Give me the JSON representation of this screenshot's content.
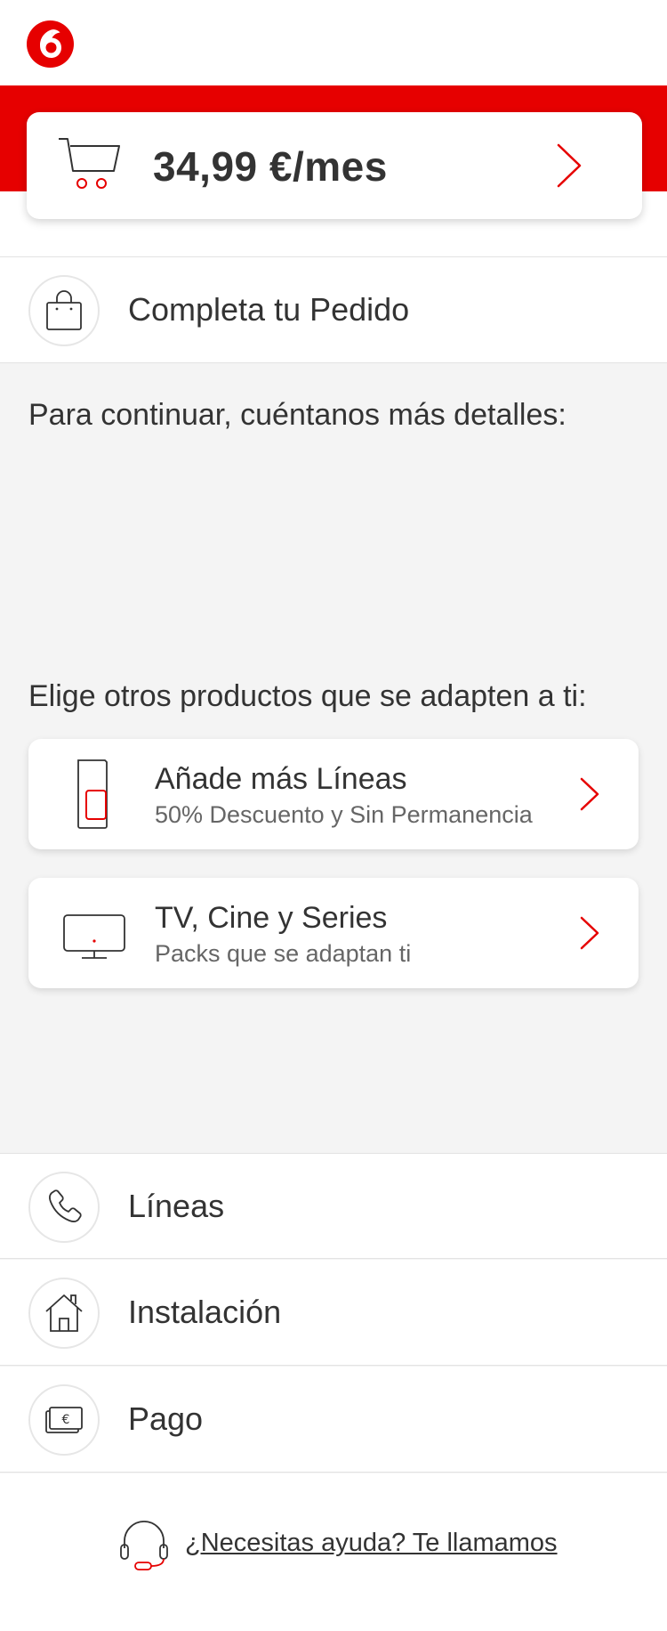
{
  "header": {
    "logo_icon": "vodafone-logo",
    "brand_color": "#e60000"
  },
  "cart": {
    "icon": "shopping-cart-icon",
    "price": "34,99 €/mes",
    "chevron_icon": "chevron-right-icon"
  },
  "steps_top": [
    {
      "label": "Completa tu Pedido",
      "icon": "shopping-bag-icon"
    }
  ],
  "section1": {
    "text": "Para continuar, cuéntanos más detalles:"
  },
  "section2": {
    "text": "Elige otros productos que se adapten a ti:"
  },
  "products": [
    {
      "title": "Añade más Líneas",
      "subtitle": "50% Descuento y Sin Permanencia",
      "icon": "sim-card-icon"
    },
    {
      "title": "TV, Cine y Series",
      "subtitle": "Packs que se adaptan ti",
      "icon": "tv-icon"
    }
  ],
  "steps_bottom": [
    {
      "label": "Líneas",
      "icon": "phone-icon"
    },
    {
      "label": "Instalación",
      "icon": "house-icon"
    },
    {
      "label": "Pago",
      "icon": "euro-bill-icon"
    }
  ],
  "help": {
    "icon": "headset-icon",
    "link_text": "¿Necesitas ayuda? Te llamamos"
  }
}
